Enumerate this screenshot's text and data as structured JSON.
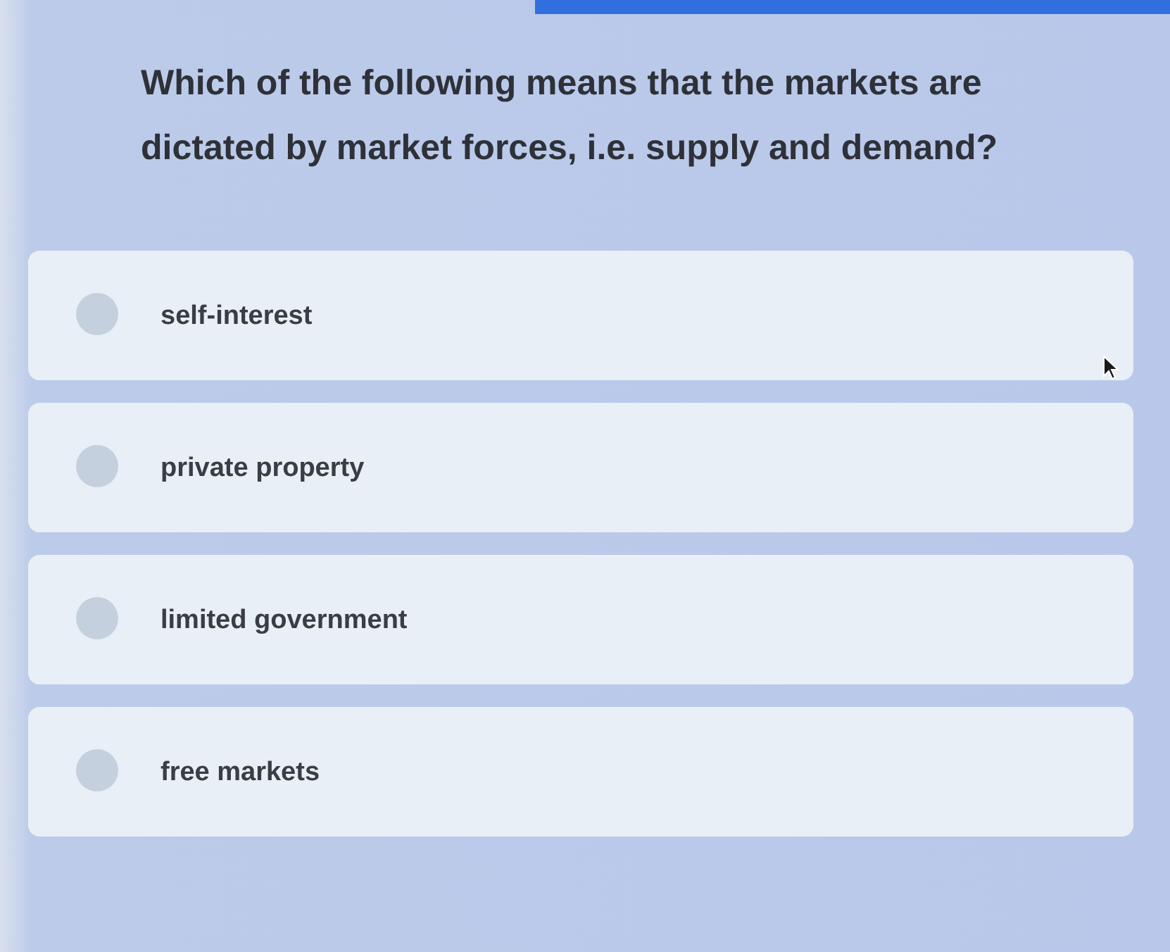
{
  "question": "Which of the following means that the markets are dictated by market forces, i.e. supply and demand?",
  "options": [
    {
      "label": "self-interest",
      "selected": false
    },
    {
      "label": "private property",
      "selected": false
    },
    {
      "label": "limited government",
      "selected": false
    },
    {
      "label": "free markets",
      "selected": false
    }
  ]
}
